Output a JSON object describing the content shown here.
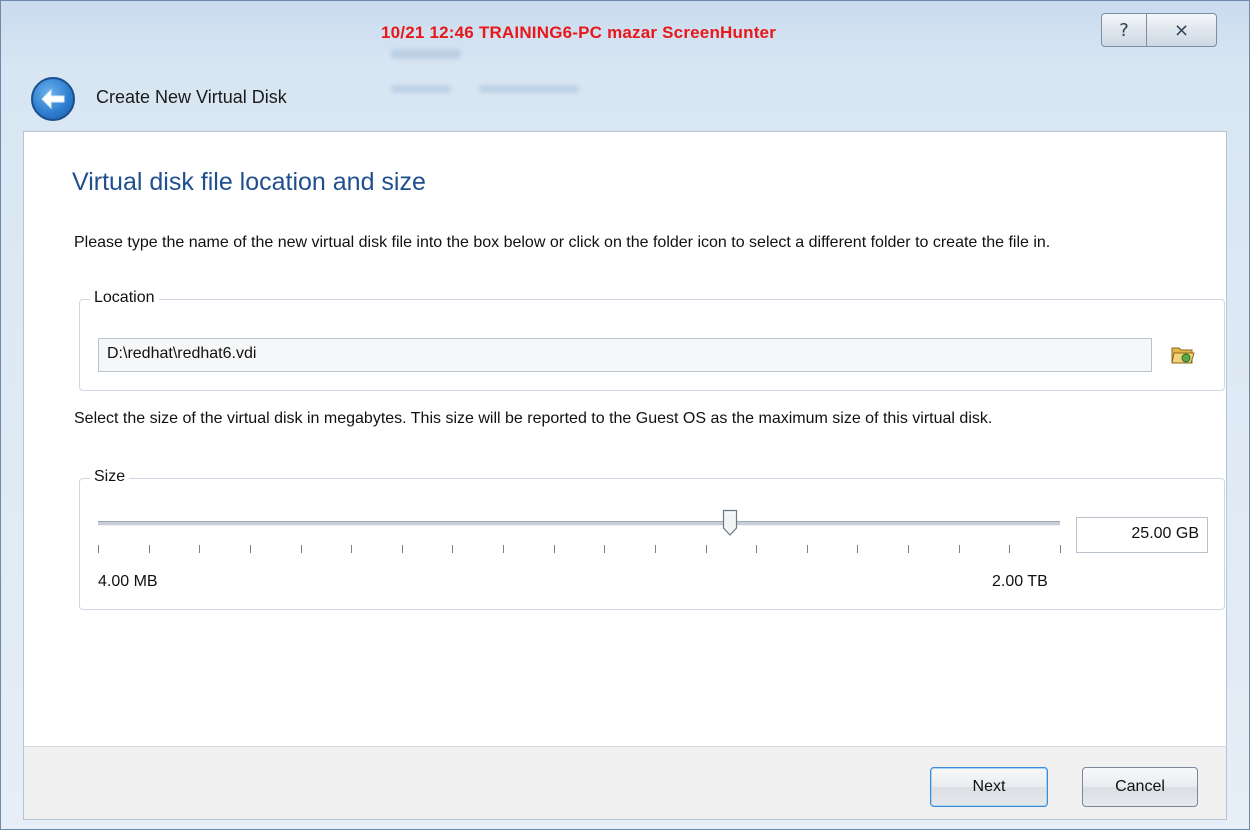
{
  "titlebar": {
    "overlay_text": "10/21 12:46 TRAINING6-PC mazar ScreenHunter",
    "help_symbol": "?",
    "close_symbol": "⨯"
  },
  "wizard": {
    "title": "Create New Virtual Disk"
  },
  "page": {
    "title": "Virtual disk file location and size",
    "location_description": "Please type the name of the new virtual disk file into the box below or click on the folder icon to select a different folder to create the file in.",
    "location_group_label": "Location",
    "location_value": "D:\\redhat\\redhat6.vdi",
    "size_description": "Select the size of the virtual disk in megabytes. This size will be reported to the Guest OS as the maximum size of this virtual disk.",
    "size_group_label": "Size",
    "size_value": "25.00 GB",
    "slider_min_label": "4.00 MB",
    "slider_max_label": "2.00 TB",
    "slider_fraction": 0.657,
    "tick_count": 20
  },
  "buttons": {
    "next": "Next",
    "cancel": "Cancel"
  },
  "icons": {
    "back": "back-arrow-icon",
    "folder": "folder-icon",
    "help": "help-icon",
    "close": "close-icon"
  },
  "colors": {
    "page_title": "#1f4f8f",
    "overlay_text": "#e8181a"
  }
}
